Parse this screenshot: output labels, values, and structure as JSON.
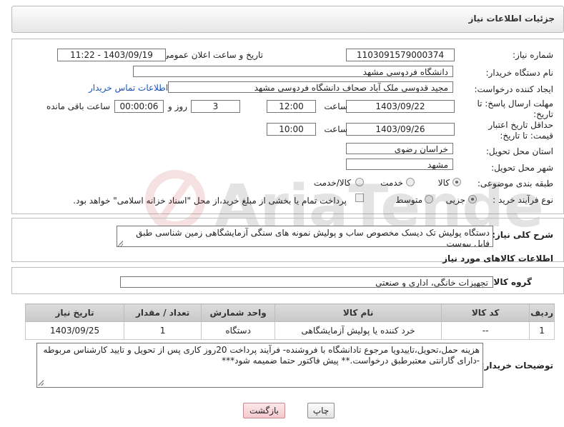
{
  "header": {
    "title": "جزئیات اطلاعات نیاز"
  },
  "form": {
    "need_number_label": "شماره نیاز:",
    "need_number": "1103091579000374",
    "announce_label": "تاریخ و ساعت اعلان عمومی:",
    "announce_value": "1403/09/19 - 11:22",
    "buyer_label": "نام دستگاه خریدار:",
    "buyer_value": "دانشگاه فردوسي مشهد",
    "creator_label": "ایجاد کننده درخواست:",
    "creator_value": "مجید قدوسی ملک آباد صحاف دانشگاه فردوسي مشهد",
    "contact_link": "اطلاعات تماس خریدار",
    "reply_label": "مهلت ارسال پاسخ: تا تاریخ:",
    "reply_date": "1403/09/22",
    "time_label": "ساعت",
    "reply_time": "12:00",
    "days_value": "3",
    "days_label": "روز و",
    "remaining_value": "00:00:06",
    "remaining_label": "ساعت باقی مانده",
    "validity_label": "حداقل تاریخ اعتبار قیمت: تا تاریخ:",
    "validity_date": "1403/09/26",
    "validity_time": "10:00",
    "province_label": "استان محل تحویل:",
    "province_value": "خراسان رضوی",
    "city_label": "شهر محل تحویل:",
    "city_value": "مشهد",
    "category_label": "طبقه بندی موضوعی:",
    "category_options": [
      "کالا",
      "خدمت",
      "کالا/خدمت"
    ],
    "purchase_label": "نوع فرآیند خرید :",
    "purchase_options": [
      "جزیی",
      "متوسط"
    ],
    "purchase_note": "پرداخت تمام یا بخشی از مبلغ خرید،از محل \"اسناد خزانه اسلامی\" خواهد بود."
  },
  "description": {
    "label": "شرح کلی نیاز:",
    "text": "دستگاه پولیش  تک دیسک مخصوص ساب  و پولیش نمونه های سنگی آزمایشگاهی زمین شناسی طبق فایل پیوست"
  },
  "goods": {
    "section_title": "اطلاعات کالاهای مورد نیاز",
    "group_label": "گروه کالا:",
    "group_value": "تجهیزات خانگی، اداری و صنعتی",
    "columns": [
      "ردیف",
      "کد کالا",
      "نام کالا",
      "واحد شمارش",
      "تعداد / مقدار",
      "تاریخ نیاز"
    ],
    "rows": [
      {
        "row": "1",
        "code": "--",
        "name": "خرد کننده یا پولیش آزمایشگاهی",
        "unit": "دستگاه",
        "qty": "1",
        "date": "1403/09/25"
      }
    ]
  },
  "buyer_notes": {
    "label": "توضیحات خریدار:",
    "text": "هزینه حمل،تحویل،تاییدویا مرجوع تادانشگاه با فروشنده- فرآیند پرداخت 20روز کاری پس از تحویل و تایید کارشناس مربوطه -دارای گارانتی معتبرطبق درخواست.** پیش فاکتور حتما ضمیمه شود***"
  },
  "buttons": {
    "print": "چاپ",
    "back": "بازگشت"
  },
  "watermark": {
    "text": "AriaTender.net"
  }
}
